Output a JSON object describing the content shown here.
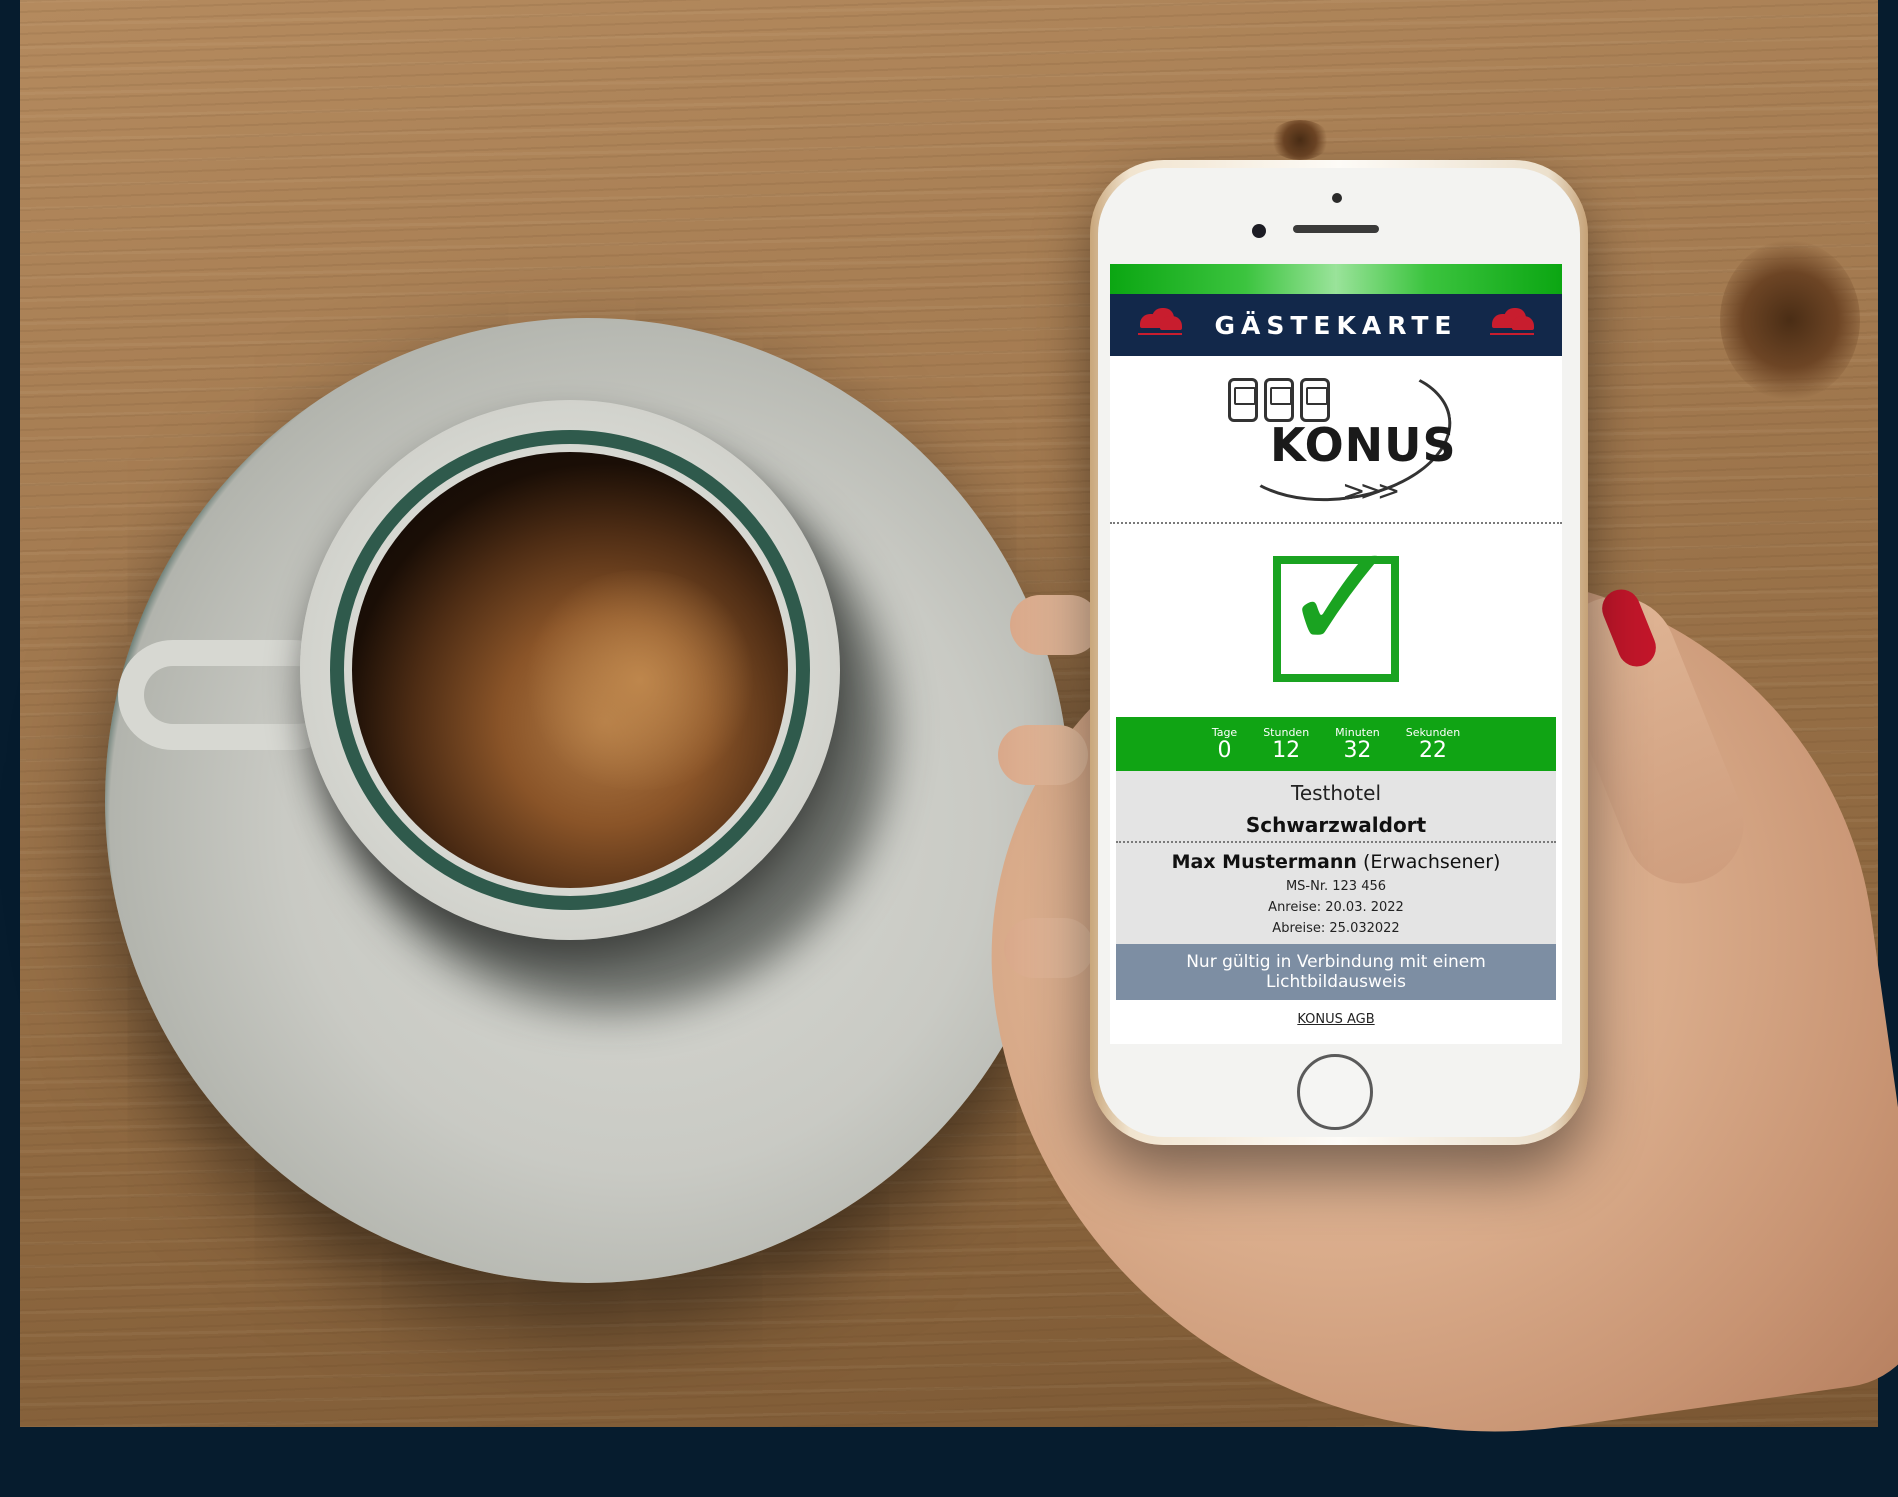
{
  "card": {
    "title": "GÄSTEKARTE",
    "brand": "KONUS",
    "status": "valid"
  },
  "countdown": {
    "days_label": "Tage",
    "days": "0",
    "hours_label": "Stunden",
    "hours": "12",
    "minutes_label": "Minuten",
    "minutes": "32",
    "seconds_label": "Sekunden",
    "seconds": "22"
  },
  "hotel": {
    "name": "Testhotel",
    "location": "Schwarzwaldort"
  },
  "guest": {
    "name": "Max Mustermann",
    "type": "(Erwachsener)",
    "ms_nr": "MS-Nr. 123 456",
    "arrival": "Anreise: 20.03. 2022",
    "departure": "Abreise: 25.032022"
  },
  "notice": "Nur gültig in Verbindung mit einem Lichtbildausweis",
  "agb_link": "KONUS AGB",
  "colors": {
    "header_bg": "#12284a",
    "accent_green": "#10a414",
    "notice_bg": "#7d8ea3"
  }
}
